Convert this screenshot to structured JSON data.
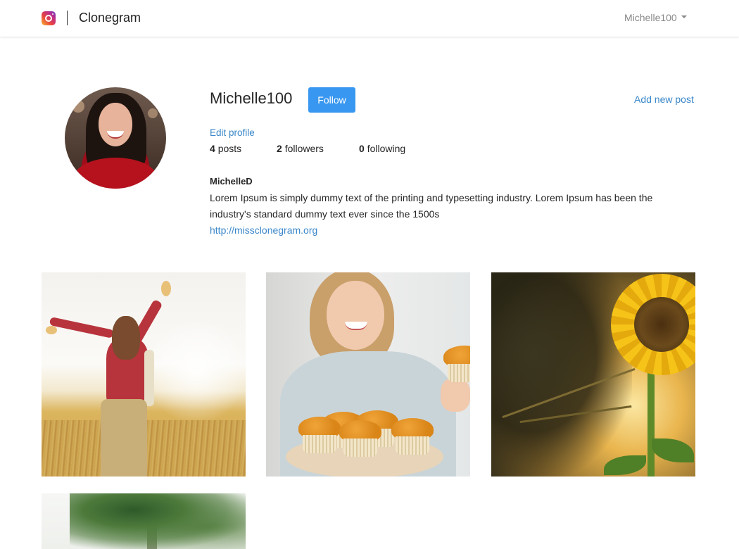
{
  "navbar": {
    "brand_icon": "instagram-logo-icon",
    "brand_name": "Clonegram",
    "user_menu_label": "Michelle100",
    "user_menu_icon": "caret-down-icon"
  },
  "profile": {
    "username": "Michelle100",
    "follow_label": "Follow",
    "add_post_label": "Add new post",
    "edit_profile_label": "Edit profile",
    "stats": {
      "posts_count": "4",
      "posts_label": "posts",
      "followers_count": "2",
      "followers_label": "followers",
      "following_count": "0",
      "following_label": "following"
    },
    "display_name": "MichelleD",
    "bio": "Lorem Ipsum is simply dummy text of the printing and typesetting industry. Lorem Ipsum has been the industry's standard dummy text ever since the 1500s",
    "website": "http://missclonegram.org"
  },
  "colors": {
    "accent": "#3897f0",
    "link": "#3a87c9",
    "text": "#262626",
    "muted": "#888888"
  },
  "posts": [
    {
      "subject": "woman-in-wheat-field"
    },
    {
      "subject": "girl-with-muffins"
    },
    {
      "subject": "sunflower-at-sunset"
    },
    {
      "subject": "palm-greenery"
    }
  ]
}
